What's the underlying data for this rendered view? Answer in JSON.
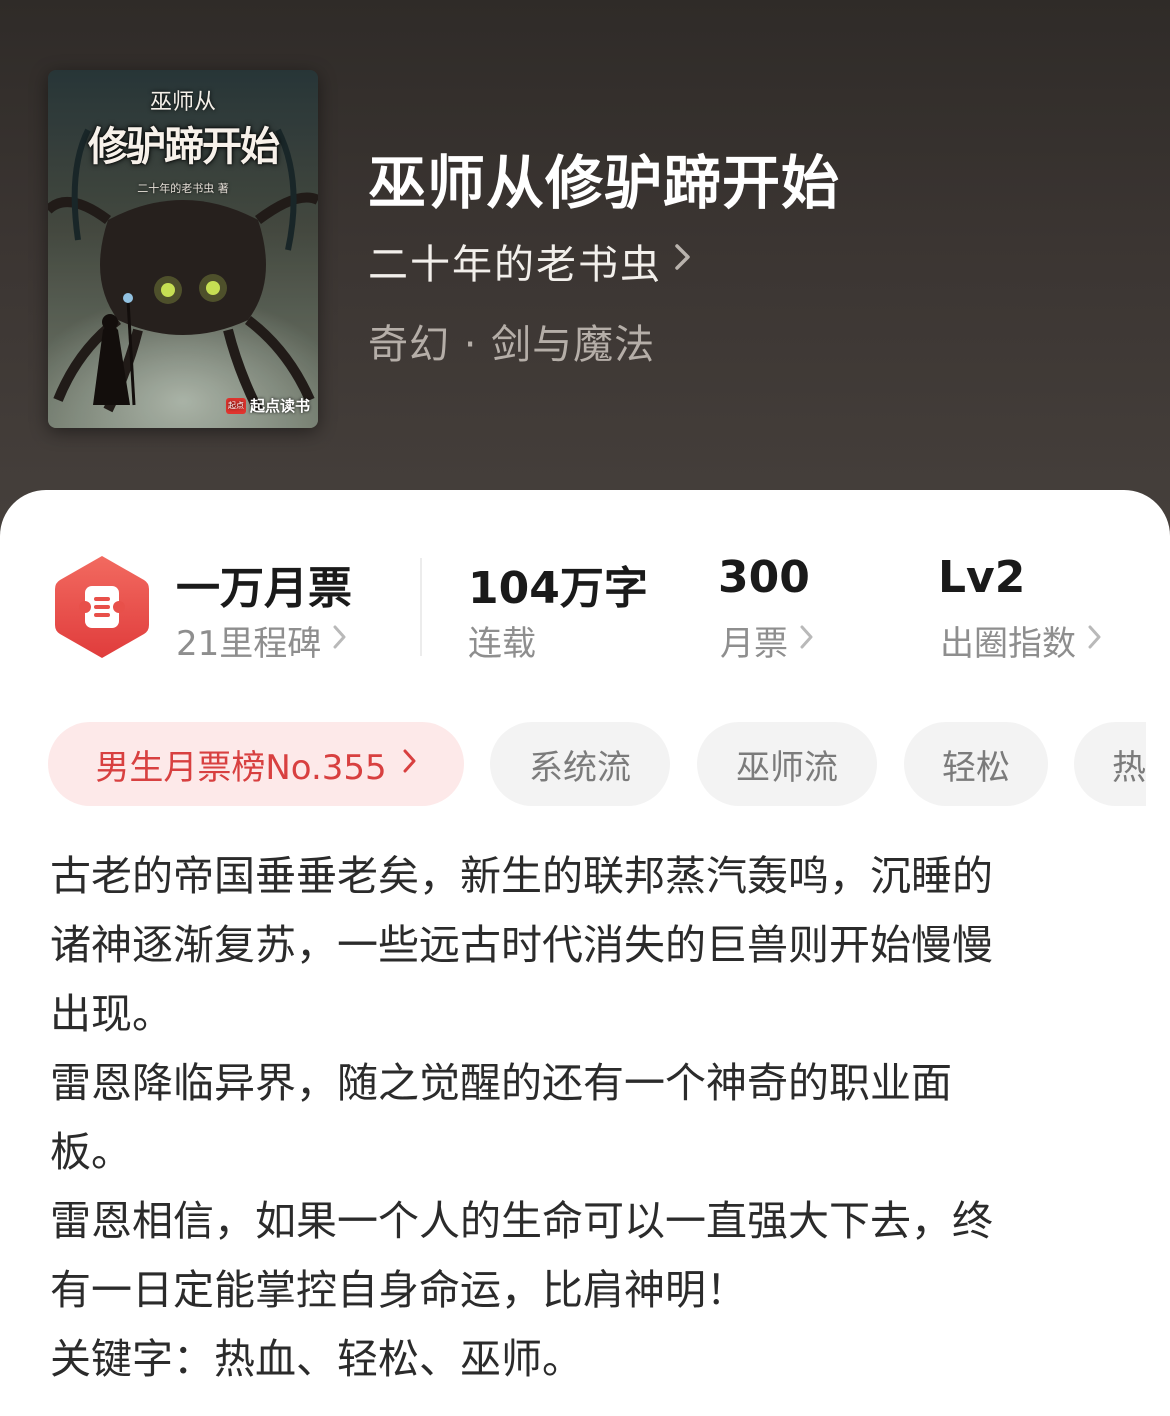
{
  "book": {
    "title": "巫师从修驴蹄开始",
    "author": "二十年的老书虫",
    "genre": "奇幻 · 剑与魔法"
  },
  "cover": {
    "title_small": "巫师从",
    "title_big": "修驴蹄开始",
    "author_line": "二十年的老书虫 著",
    "publisher": "起点读书",
    "publisher_mark": "起点"
  },
  "stats": {
    "badge": {
      "title": "一万月票",
      "subtitle": "21里程碑"
    },
    "words": {
      "value": "104万字",
      "label": "连载"
    },
    "monthly_tickets": {
      "value": "300",
      "label": "月票"
    },
    "influence": {
      "value": "Lv2",
      "label": "出圈指数"
    }
  },
  "tags": [
    {
      "label": "男生月票榜No.355"
    },
    {
      "label": "系统流"
    },
    {
      "label": "巫师流"
    },
    {
      "label": "轻松"
    },
    {
      "label": "热"
    }
  ],
  "description": [
    "古老的帝国垂垂老矣，新生的联邦蒸汽轰鸣，沉睡的",
    "诸神逐渐复苏，一些远古时代消失的巨兽则开始慢慢",
    "出现。",
    "雷恩降临异界，随之觉醒的还有一个神奇的职业面",
    "板。",
    "雷恩相信，如果一个人的生命可以一直强大下去，终",
    "有一日定能掌控自身命运，比肩神明！",
    "关键字：热血、轻松、巫师。"
  ],
  "colors": {
    "accent": "#e84a4a",
    "rank_tag_bg": "#fde9e9",
    "hero_bg": "#3b3532"
  }
}
